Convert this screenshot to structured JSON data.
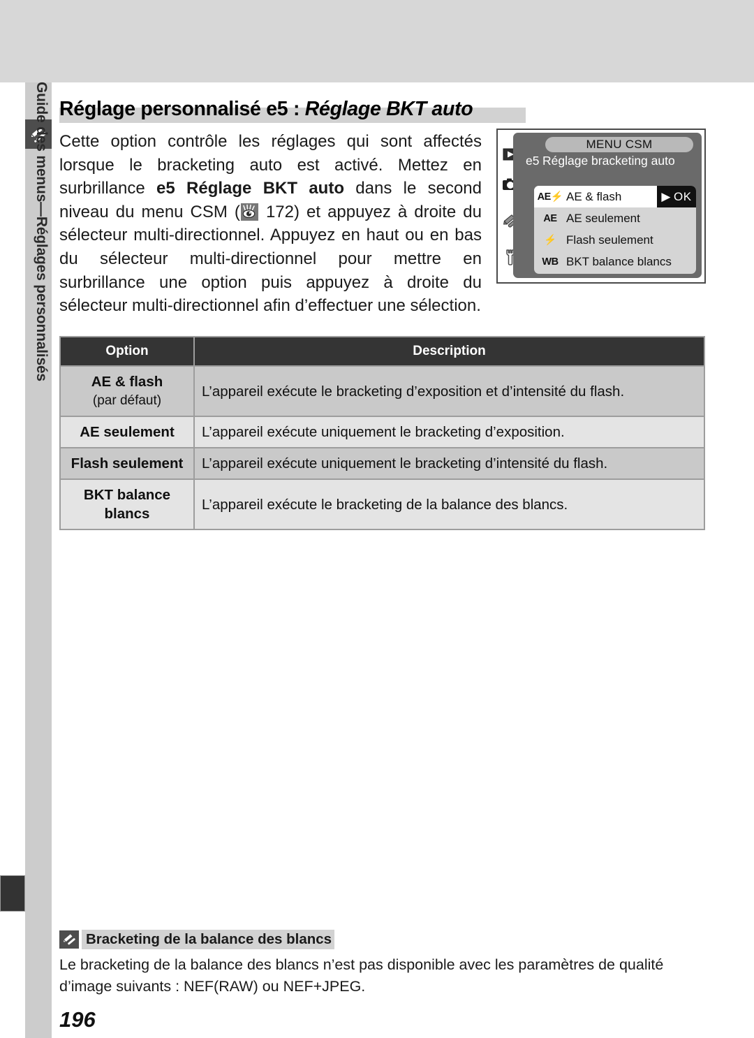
{
  "sidebar": {
    "tab_label": "Guide des menus—Réglages personnalisés",
    "icon": "pencil-icon"
  },
  "heading": {
    "title_plain": "Réglage personnalisé e5 : ",
    "title_italic": "Réglage BKT auto"
  },
  "intro": {
    "part1": "Cette option contrôle les réglages qui sont affectés lorsque le bracketing auto est activé. Mettez en surbrillance ",
    "bold": "e5 Réglage BKT auto",
    "part2": " dans le second niveau du menu CSM (",
    "ref_icon": "searching-eye-icon",
    "ref_page": " 172) et appuyez à droite du sélecteur multi-directionnel. Appuyez en haut ou en bas du sélecteur multi-directionnel pour mettre en surbrillance une option puis appuyez à droite du sélecteur multi-directionnel afin d’effectuer une sélection."
  },
  "lcd": {
    "menu_title": "MENU CSM",
    "item_number": "e5",
    "item_heading": "Réglage bracketing auto",
    "ok_arrow": "▶",
    "ok_label": "OK",
    "side_tabs": [
      {
        "name": "playback-tab-icon",
        "glyph": "▶"
      },
      {
        "name": "shooting-menu-tab-icon",
        "glyph": "camera"
      },
      {
        "name": "custom-settings-tab-icon",
        "glyph": "pencil"
      },
      {
        "name": "setup-menu-tab-icon",
        "glyph": "wrench"
      }
    ],
    "rows": [
      {
        "icon": "AE⚡",
        "icon_name": "ae-flash-icon",
        "label": "AE & flash",
        "selected": true
      },
      {
        "icon": "AE",
        "icon_name": "ae-icon",
        "label": "AE seulement",
        "selected": false
      },
      {
        "icon": "⚡",
        "icon_name": "flash-icon",
        "label": "Flash seulement",
        "selected": false
      },
      {
        "icon": "WB",
        "icon_name": "wb-icon",
        "label": "BKT balance blancs",
        "selected": false
      }
    ]
  },
  "table": {
    "headers": [
      "Option",
      "Description"
    ],
    "rows": [
      {
        "option": "AE & flash",
        "option_sub": "(par défaut)",
        "description": "L’appareil exécute le bracketing d’exposition et d’intensité du flash."
      },
      {
        "option": "AE seulement",
        "option_sub": "",
        "description": "L’appareil exécute uniquement le bracketing d’exposition."
      },
      {
        "option": "Flash seulement",
        "option_sub": "",
        "description": "L’appareil exécute uniquement le bracketing d’intensité du flash."
      },
      {
        "option": "BKT balance blancs",
        "option_sub": "",
        "description": "L’appareil exécute le bracketing de la balance des blancs."
      }
    ]
  },
  "note": {
    "icon": "pencil-icon",
    "heading": "Bracketing de la balance des blancs",
    "body": "Le bracketing de la balance des blancs n’est pas disponible avec les paramètres de qualité d’image suivants : NEF(RAW) ou NEF+JPEG."
  },
  "page_number": "196",
  "colors": {
    "top_band": "#d7d7d7",
    "sidebar_strip": "#cccccc",
    "table_header": "#343434",
    "row_dark": "#c9c9c9",
    "row_light": "#e4e4e4",
    "highlight": "#d2d2d2",
    "lcd_body": "#6a6a6a"
  }
}
